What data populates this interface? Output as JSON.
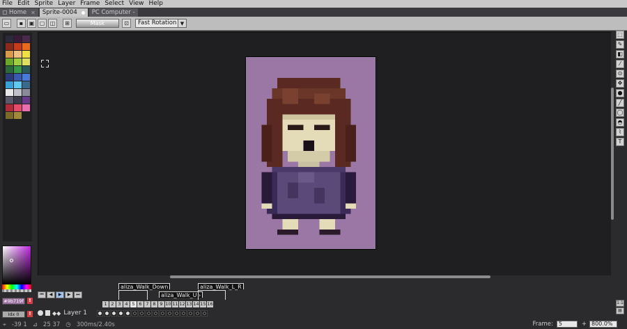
{
  "menu": [
    "File",
    "Edit",
    "Sprite",
    "Layer",
    "Frame",
    "Select",
    "View",
    "Help"
  ],
  "tabs": [
    {
      "label": "Home",
      "active": false
    },
    {
      "label": "Sprite-0004",
      "active": true
    },
    {
      "label": "PC Computer -",
      "active": false
    }
  ],
  "toolbar": {
    "mask_label": "Mask",
    "rotation_value": "Fast Rotation"
  },
  "palette": [
    "#2a2a3a",
    "#3a1a3a",
    "#4a2a4a",
    "#8a2a1a",
    "#c83a1a",
    "#e86a1a",
    "#d89a4a",
    "#f0c080",
    "#f0e040",
    "#6aa82a",
    "#a0d040",
    "#e0e060",
    "#2a6a3a",
    "#3a9a4a",
    "#2a5a5a",
    "#2a3a7a",
    "#3a5ab0",
    "#4a7ad8",
    "#3aa0d8",
    "#60c8f0",
    "#3a6a8a",
    "#e8e8e8",
    "#c0c0c8",
    "#8a8a98",
    "#5a5a6a",
    "#3a3a4a",
    "#6a3a8a",
    "#b02a3a",
    "#e84a6a",
    "#e870b0",
    "#7a6a2a",
    "#a08a3a"
  ],
  "colors": {
    "fg_hex": "#9b719f",
    "bg_label": "Idx 0"
  },
  "timeline": {
    "tags": [
      "aliza_Walk_Down",
      "aliza_Walk_U",
      "aliza_Walk_L_R"
    ],
    "layer_name": "Layer 1",
    "frames": [
      "1",
      "2",
      "3",
      "4",
      "5",
      "6",
      "7",
      "8",
      "9",
      "10",
      "11",
      "12",
      "13",
      "14",
      "15",
      "16"
    ],
    "active_frame_index": 4
  },
  "status": {
    "coords": "-39 1",
    "size": "25 37",
    "timing": "300ms/2.40s",
    "frame_label": "Frame:",
    "frame_value": "5",
    "zoom_value": "800.0%",
    "plus": "+"
  },
  "icons": {
    "tools": [
      "marquee-icon",
      "pencil-icon",
      "eraser-icon",
      "eyedropper-icon",
      "zoom-icon",
      "move-icon",
      "paint-bucket-icon",
      "line-icon",
      "ellipse-icon",
      "lasso-icon",
      "blur-icon",
      "text-icon"
    ]
  }
}
